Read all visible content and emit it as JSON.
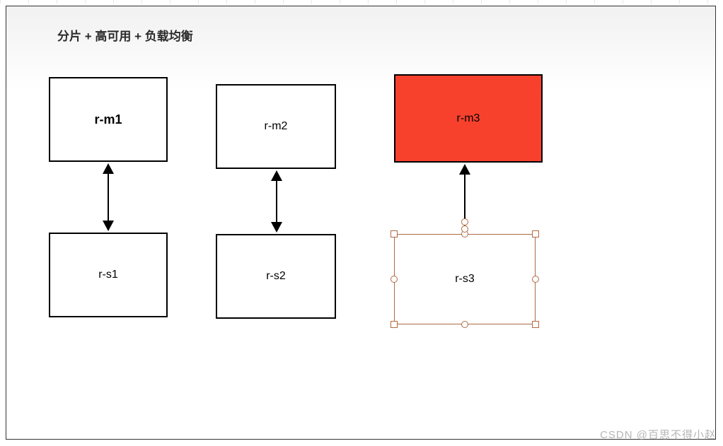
{
  "title": "分片 + 高可用 + 负载均衡",
  "nodes": {
    "m1": "r-m1",
    "m2": "r-m2",
    "m3": "r-m3",
    "s1": "r-s1",
    "s2": "r-s2",
    "s3": "r-s3"
  },
  "colors": {
    "highlight": "#F7412D",
    "selection": "#b06a43"
  },
  "watermark": "CSDN @百思不得小赵"
}
